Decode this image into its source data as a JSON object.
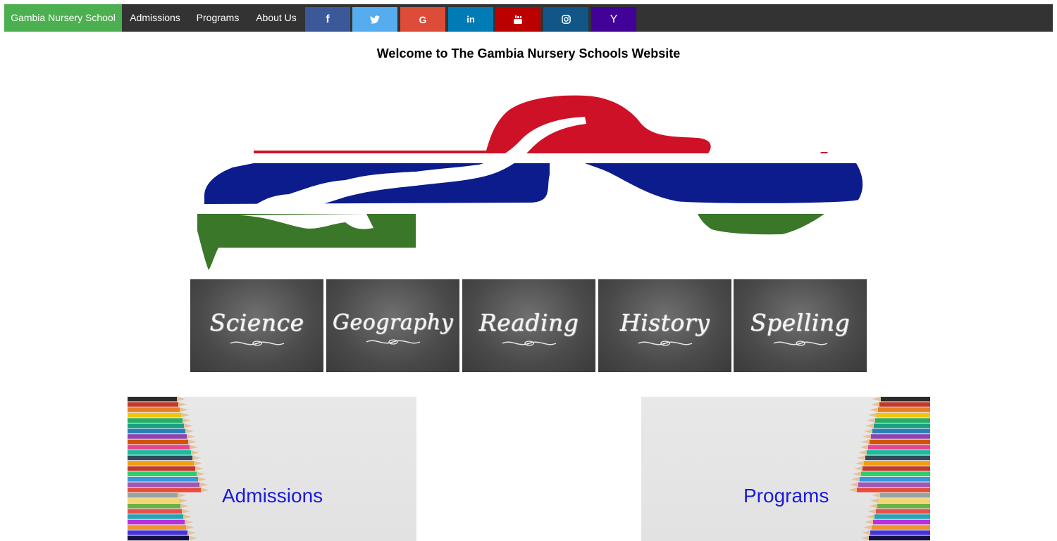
{
  "nav": {
    "brand": "Gambia Nursery School",
    "links": [
      "Admissions",
      "Programs",
      "About Us"
    ]
  },
  "social": [
    {
      "name": "facebook",
      "glyph": "f",
      "color": "#3b5998"
    },
    {
      "name": "twitter",
      "glyph": "",
      "color": "#55acee"
    },
    {
      "name": "google",
      "glyph": "G",
      "color": "#dd4b39"
    },
    {
      "name": "linkedin",
      "glyph": "in",
      "color": "#007bb5"
    },
    {
      "name": "youtube",
      "glyph": "",
      "color": "#bb0000"
    },
    {
      "name": "instagram",
      "glyph": "",
      "color": "#125688"
    },
    {
      "name": "yahoo",
      "glyph": "Y",
      "color": "#430297"
    }
  ],
  "headline": "Welcome to The Gambia Nursery Schools Website",
  "subjects": [
    "Science",
    "Geography",
    "Reading",
    "History",
    "Spelling"
  ],
  "cards": {
    "admissions": "Admissions",
    "programs": "Programs"
  },
  "flag_colors": {
    "red": "#ce1126",
    "blue": "#0c1c8c",
    "green": "#3a7728"
  }
}
